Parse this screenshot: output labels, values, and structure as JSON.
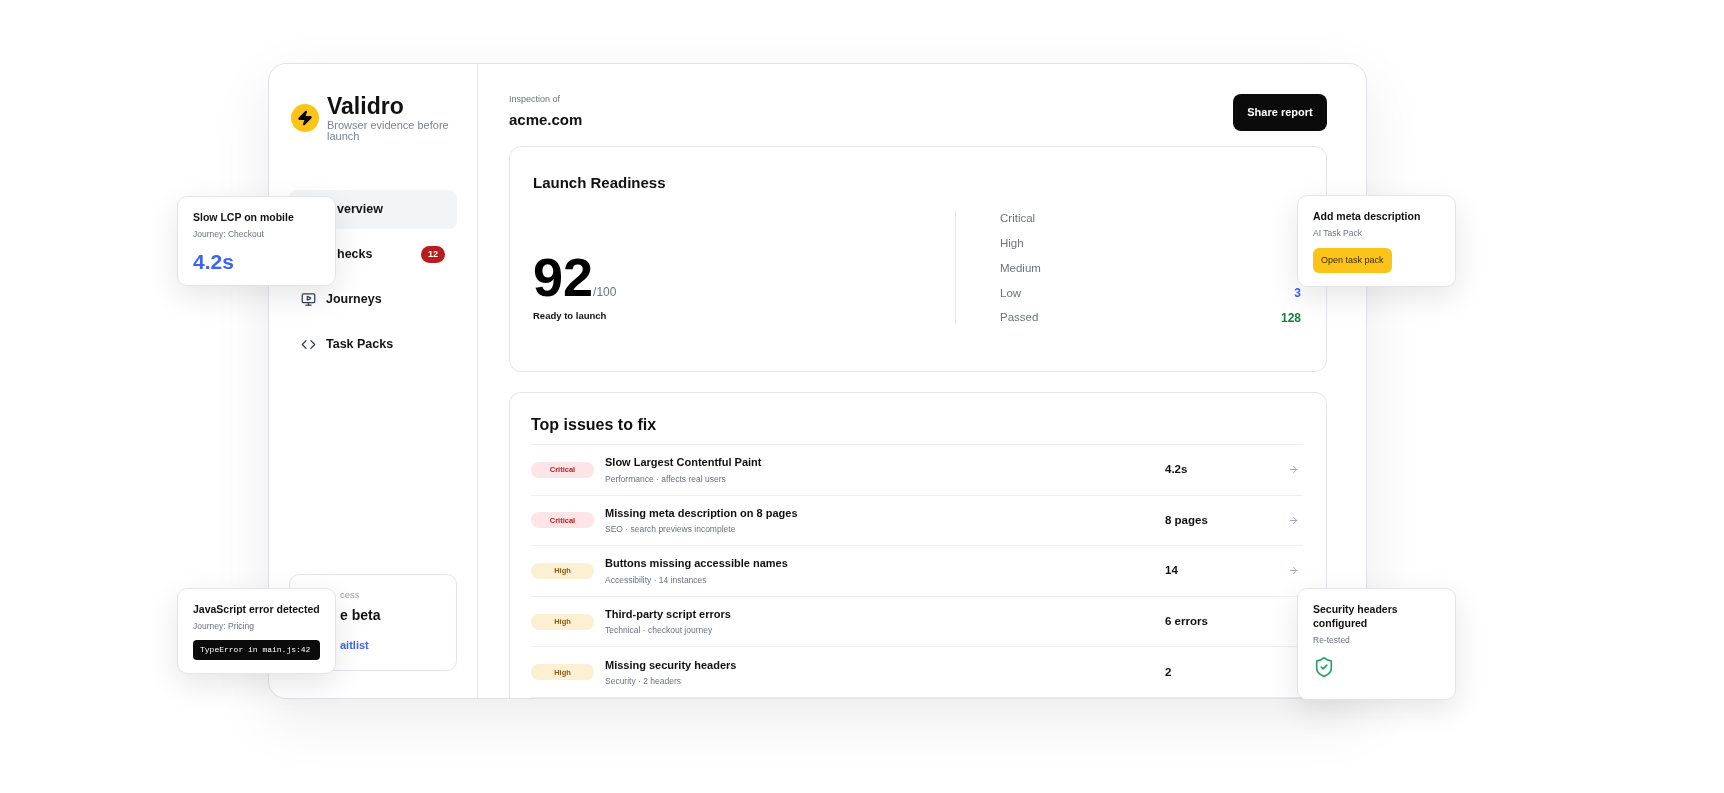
{
  "brand": {
    "name": "Validro",
    "tagline": "Browser evidence before launch"
  },
  "nav": [
    {
      "label": "verview",
      "selected": true
    },
    {
      "label": "hecks",
      "selected": false,
      "badge": "12"
    },
    {
      "label": "Journeys",
      "selected": false
    },
    {
      "label": "Task Packs",
      "selected": false
    }
  ],
  "access_card": {
    "eyebrow": "cess",
    "title": "e beta",
    "link": "aitlist"
  },
  "header": {
    "eyebrow": "Inspection of",
    "site": "acme.com",
    "button": "Share report"
  },
  "readiness": {
    "title": "Launch Readiness",
    "score": "92",
    "out_of": "/100",
    "status": "Ready to launch",
    "levels": [
      {
        "label": "Critical"
      },
      {
        "label": "High"
      },
      {
        "label": "Medium"
      },
      {
        "label": "Low",
        "value": "3",
        "color": "#3b63f6"
      },
      {
        "label": "Passed",
        "value": "128",
        "color": "#15803d"
      }
    ]
  },
  "issues": {
    "title": "Top issues to fix",
    "rows": [
      {
        "kind": "critical",
        "badge": "Critical",
        "title": "Slow Largest Contentful Paint",
        "meta": "Performance · affects real users",
        "value": "4.2s",
        "arrow": true
      },
      {
        "kind": "critical",
        "badge": "Critical",
        "title": "Missing meta description on 8 pages",
        "meta": "SEO · search previews incomplete",
        "value": "8 pages",
        "arrow": true
      },
      {
        "kind": "high",
        "badge": "High",
        "title": "Buttons missing accessible names",
        "meta": "Accessibility · 14 instances",
        "value": "14",
        "arrow": true
      },
      {
        "kind": "high",
        "badge": "High",
        "title": "Third-party script errors",
        "meta": "Technical · checkout journey",
        "value": "6 errors",
        "arrow": false
      },
      {
        "kind": "high",
        "badge": "High",
        "title": "Missing security headers",
        "meta": "Security · 2 headers",
        "value": "2",
        "arrow": false
      }
    ]
  },
  "floating_cards": [
    {
      "kind": "metric",
      "title": "Slow LCP on mobile",
      "subtitle": "Journey: Checkout",
      "metric": "4.2s"
    },
    {
      "kind": "code",
      "title": "JavaScript error detected",
      "subtitle": "Journey: Pricing",
      "code": "TypeError in main.js:42"
    },
    {
      "kind": "action",
      "title": "Add meta description",
      "subtitle": "AI Task Pack",
      "button": "Open task pack"
    },
    {
      "kind": "status",
      "title": "Security headers configured",
      "subtitle": "Re-tested"
    }
  ]
}
